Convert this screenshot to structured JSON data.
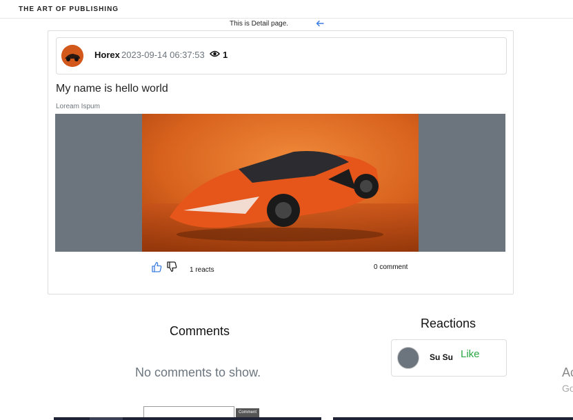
{
  "header": {
    "tagline": "THE ART OF PUBLISHING",
    "detail_text": "This is Detail page."
  },
  "post": {
    "author": "Horex",
    "date": "2023-09-14 06:37:53",
    "views": "1",
    "title": "My name is hello world",
    "subtitle": "Loream Ispum",
    "reacts": "1 reacts",
    "comments_count": "0 comment"
  },
  "comments": {
    "heading": "Comments",
    "empty_text": "No comments to show.",
    "submit_label": "Comment"
  },
  "reactions": {
    "heading": "Reactions",
    "items": [
      {
        "name": "Su Su",
        "type": "Like"
      }
    ]
  },
  "ad": {
    "line1": "Ac",
    "line2": "Go"
  },
  "colors": {
    "accent_red": "#d1252f",
    "muted": "#6c757d",
    "like_green": "#28a745",
    "link_blue": "#3d7ce0"
  },
  "icons": [
    "back-arrow-icon",
    "eye-icon",
    "thumbs-up-icon",
    "thumbs-down-icon"
  ]
}
